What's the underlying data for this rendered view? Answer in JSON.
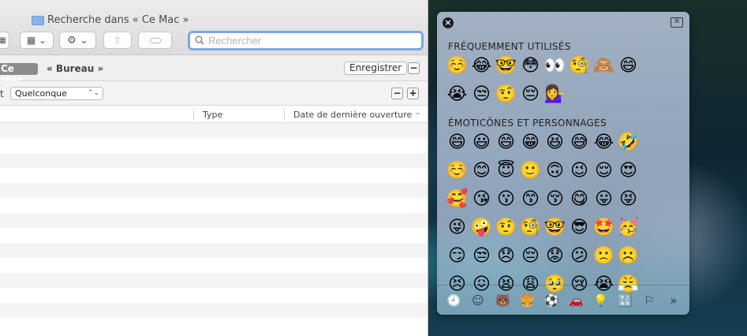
{
  "finder": {
    "window_title": "Recherche dans « Ce Mac »",
    "toolbar": {
      "view_icon": "grid-view-icon",
      "action_icon": "gear-icon",
      "share_icon": "share-icon",
      "tag_icon": "tag-icon"
    },
    "search": {
      "placeholder": "Rechercher",
      "value": ""
    },
    "scope": {
      "selected": "Ce Mac",
      "other": "« Bureau »",
      "save_label": "Enregistrer",
      "remove_label": "−"
    },
    "criteria": {
      "label": "t",
      "select_value": "Quelconque",
      "remove_label": "−",
      "add_label": "+"
    },
    "columns": [
      "Type",
      "Date de dernière ouverture"
    ]
  },
  "picker": {
    "sections": [
      {
        "title": "FRÉQUEMMENT UTILISÉS",
        "emojis": [
          "☺️",
          "😂",
          "🤓",
          "😳",
          "👀",
          "🧐",
          "🙈",
          "😄",
          "😭",
          "😒",
          "🤨",
          "😔",
          "💁‍♀️"
        ]
      },
      {
        "title": "ÉMOTICÔNES ET PERSONNAGES",
        "emojis": [
          "😄",
          "😃",
          "😄",
          "😁",
          "😆",
          "😅",
          "😂",
          "🤣",
          "☺️",
          "😊",
          "😇",
          "🙂",
          "🙃",
          "😉",
          "😌",
          "😍",
          "🥰",
          "😘",
          "😗",
          "😙",
          "😚",
          "😋",
          "😛",
          "😝",
          "😜",
          "🤪",
          "🤨",
          "🧐",
          "🤓",
          "😎",
          "🤩",
          "🥳",
          "😏",
          "😒",
          "😞",
          "😔",
          "😟",
          "😕",
          "🙁",
          "☹️",
          "😣",
          "😖",
          "😫",
          "😩",
          "🥺",
          "😢",
          "😭",
          "😤"
        ]
      }
    ],
    "categories": [
      {
        "icon": "clock-icon",
        "glyph": "🕘"
      },
      {
        "icon": "smiley-icon",
        "glyph": "☺"
      },
      {
        "icon": "bear-icon",
        "glyph": "🐻"
      },
      {
        "icon": "food-icon",
        "glyph": "🍔"
      },
      {
        "icon": "ball-icon",
        "glyph": "⚽"
      },
      {
        "icon": "car-icon",
        "glyph": "🚗"
      },
      {
        "icon": "bulb-icon",
        "glyph": "💡"
      },
      {
        "icon": "symbols-icon",
        "glyph": "🔣"
      },
      {
        "icon": "flag-icon",
        "glyph": "⚐"
      },
      {
        "icon": "more-icon",
        "glyph": "»"
      }
    ]
  }
}
